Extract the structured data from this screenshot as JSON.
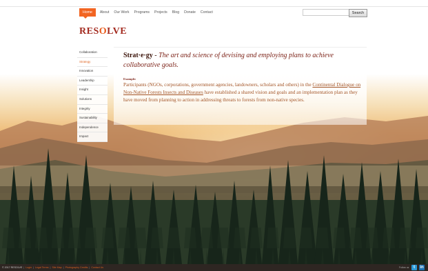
{
  "nav": {
    "items": [
      "Home",
      "About",
      "Our Work",
      "Programs",
      "Projects",
      "Blog",
      "Donate",
      "Contact"
    ],
    "active": "Home"
  },
  "search": {
    "value": "",
    "button_label": "Search"
  },
  "logo": {
    "part1": "RES",
    "part2": "O",
    "part3": "LVE"
  },
  "sidebar": {
    "items": [
      "Collaboration",
      "Strategy",
      "Innovation",
      "Leadership",
      "Insight",
      "Solutions",
      "Integrity",
      "Sustainability",
      "Independence",
      "Impact"
    ],
    "active": "Strategy"
  },
  "content": {
    "term": "Strat·e·gy",
    "dash": " - ",
    "meaning": "The art and science of devising and employing plans to achieve collaborative goals.",
    "example_label": "Example:",
    "example_text_1": "Participants (NGOs, corporations, government agencies, landowners, scholars and others) in the ",
    "example_link": "Continental Dialogue on Non-Native Forests Insects and Diseases",
    "example_text_2": " have established a shared vision and goals and an implementation plan as they have moved from planning to action in addressing threats to forests from non-native species."
  },
  "footer": {
    "copyright": "© 2017 RESOLVE",
    "links": [
      "Login",
      "Legal Terms",
      "Site Map",
      "Photography Credits",
      "Contact Us"
    ],
    "follow": "Follow us",
    "social": [
      "twitter-icon",
      "linkedin-icon"
    ]
  },
  "colors": {
    "accent": "#f26522",
    "brand": "#a32a1f",
    "footer_bg": "#2e2622"
  }
}
